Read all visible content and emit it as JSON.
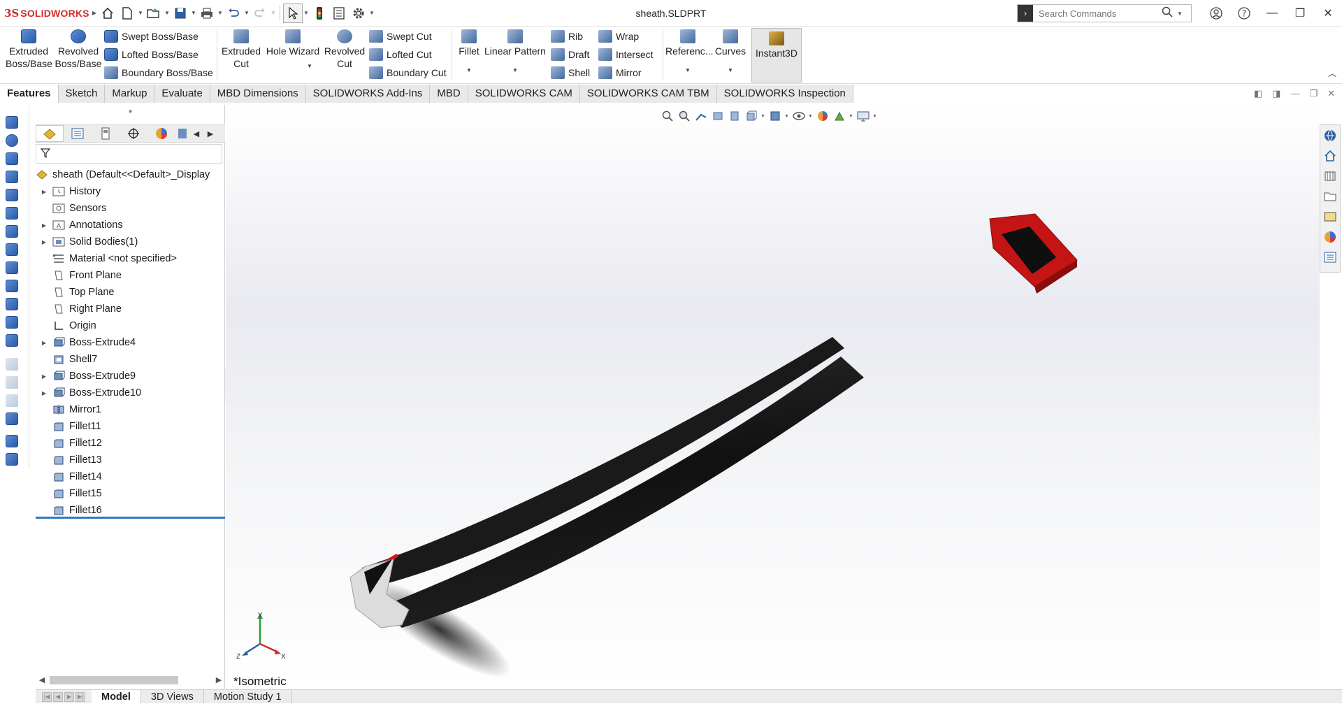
{
  "app": {
    "brand_ds": "3S",
    "brand_name": "SOLIDWORKS",
    "document_title": "sheath.SLDPRT"
  },
  "search": {
    "placeholder": "Search Commands"
  },
  "command_manager": {
    "extruded_boss": [
      "Extruded",
      "Boss/Base"
    ],
    "revolved_boss": [
      "Revolved",
      "Boss/Base"
    ],
    "swept_boss": "Swept Boss/Base",
    "lofted_boss": "Lofted Boss/Base",
    "boundary_boss": "Boundary Boss/Base",
    "extruded_cut": [
      "Extruded",
      "Cut"
    ],
    "hole_wizard": "Hole Wizard",
    "revolved_cut": [
      "Revolved",
      "Cut"
    ],
    "swept_cut": "Swept Cut",
    "lofted_cut": "Lofted Cut",
    "boundary_cut": "Boundary Cut",
    "fillet": "Fillet",
    "linear_pattern": "Linear Pattern",
    "rib": "Rib",
    "draft": "Draft",
    "shell": "Shell",
    "wrap": "Wrap",
    "intersect": "Intersect",
    "mirror": "Mirror",
    "reference": "Referenc...",
    "curves": "Curves",
    "instant3d": "Instant3D"
  },
  "tabs": [
    "Features",
    "Sketch",
    "Markup",
    "Evaluate",
    "MBD Dimensions",
    "SOLIDWORKS Add-Ins",
    "MBD",
    "SOLIDWORKS CAM",
    "SOLIDWORKS CAM TBM",
    "SOLIDWORKS Inspection"
  ],
  "feature_tree": {
    "root": "sheath  (Default<<Default>_Display",
    "items": [
      {
        "label": "History",
        "icon": "history-folder-icon",
        "expandable": true
      },
      {
        "label": "Sensors",
        "icon": "sensors-icon",
        "expandable": false
      },
      {
        "label": "Annotations",
        "icon": "annotations-icon",
        "expandable": true
      },
      {
        "label": "Solid Bodies(1)",
        "icon": "solid-bodies-icon",
        "expandable": true
      },
      {
        "label": "Material <not specified>",
        "icon": "material-icon",
        "expandable": false
      },
      {
        "label": "Front Plane",
        "icon": "plane-icon",
        "expandable": false
      },
      {
        "label": "Top Plane",
        "icon": "plane-icon",
        "expandable": false
      },
      {
        "label": "Right Plane",
        "icon": "plane-icon",
        "expandable": false
      },
      {
        "label": "Origin",
        "icon": "origin-icon",
        "expandable": false
      },
      {
        "label": "Boss-Extrude4",
        "icon": "boss-extrude-icon",
        "expandable": true
      },
      {
        "label": "Shell7",
        "icon": "shell-icon",
        "expandable": false
      },
      {
        "label": "Boss-Extrude9",
        "icon": "boss-extrude-icon",
        "expandable": true
      },
      {
        "label": "Boss-Extrude10",
        "icon": "boss-extrude-icon",
        "expandable": true
      },
      {
        "label": "Mirror1",
        "icon": "mirror-icon",
        "expandable": false
      },
      {
        "label": "Fillet11",
        "icon": "fillet-icon",
        "expandable": false
      },
      {
        "label": "Fillet12",
        "icon": "fillet-icon",
        "expandable": false
      },
      {
        "label": "Fillet13",
        "icon": "fillet-icon",
        "expandable": false
      },
      {
        "label": "Fillet14",
        "icon": "fillet-icon",
        "expandable": false
      },
      {
        "label": "Fillet15",
        "icon": "fillet-icon",
        "expandable": false
      },
      {
        "label": "Fillet16",
        "icon": "fillet-icon",
        "expandable": false
      }
    ]
  },
  "viewport": {
    "view_name": "*Isometric",
    "triad": {
      "y": "Y",
      "x": "X",
      "z": "Z"
    },
    "colors": {
      "body": "#141414",
      "accent": "#d01818",
      "cap": "#d9d9d9"
    }
  },
  "bottom_tabs": [
    "Model",
    "3D Views",
    "Motion Study 1"
  ]
}
